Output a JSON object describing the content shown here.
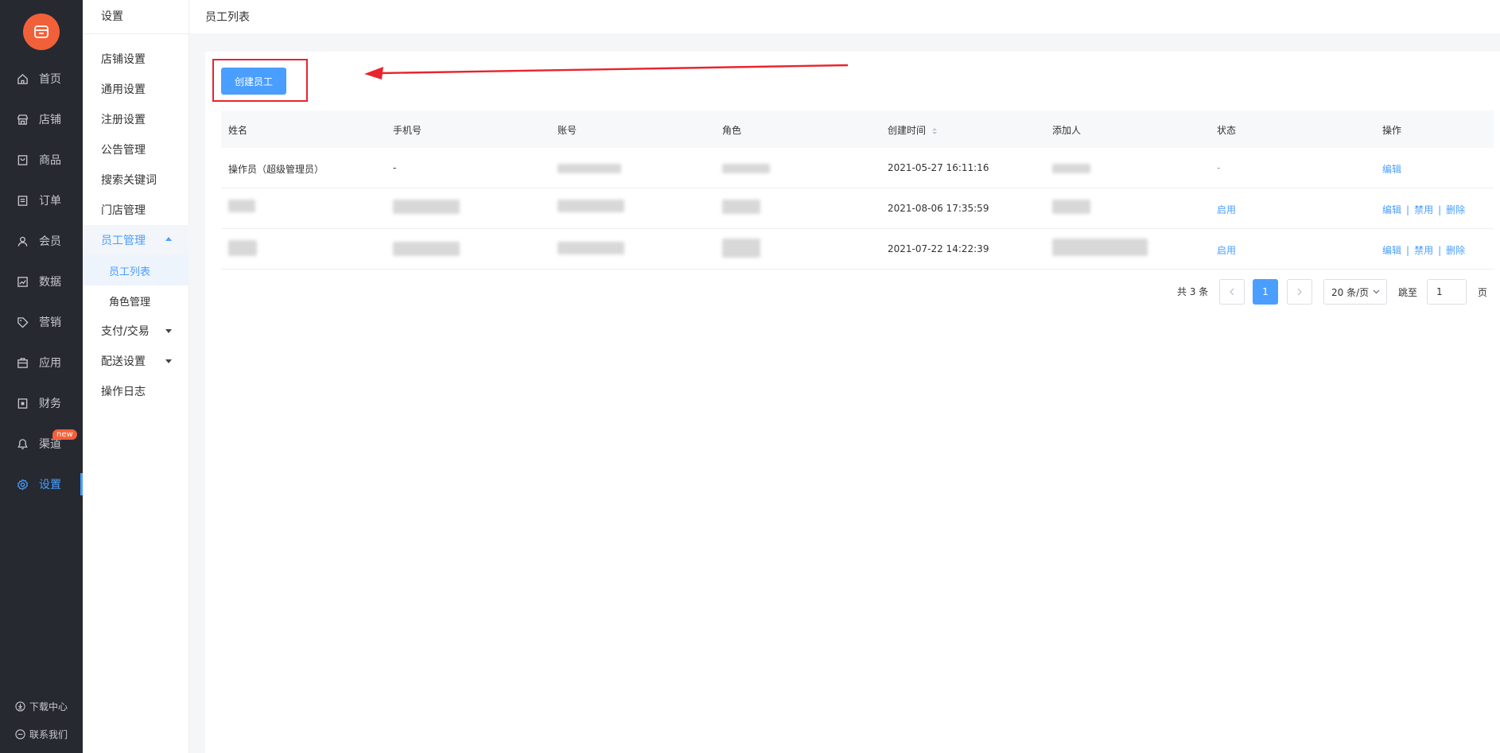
{
  "nav": {
    "items": [
      {
        "label": "首页",
        "icon": "home-icon"
      },
      {
        "label": "店铺",
        "icon": "store-icon"
      },
      {
        "label": "商品",
        "icon": "goods-icon"
      },
      {
        "label": "订单",
        "icon": "order-icon"
      },
      {
        "label": "会员",
        "icon": "member-icon"
      },
      {
        "label": "数据",
        "icon": "chart-icon"
      },
      {
        "label": "营销",
        "icon": "tag-icon"
      },
      {
        "label": "应用",
        "icon": "app-icon"
      },
      {
        "label": "财务",
        "icon": "finance-icon"
      },
      {
        "label": "渠道",
        "icon": "channel-icon",
        "badge": "new"
      },
      {
        "label": "设置",
        "icon": "gear-icon",
        "active": true
      }
    ],
    "footer": [
      {
        "label": "下载中心",
        "icon": "download-icon"
      },
      {
        "label": "联系我们",
        "icon": "chat-icon"
      }
    ]
  },
  "sub": {
    "title": "设置",
    "items": [
      {
        "label": "店铺设置"
      },
      {
        "label": "通用设置"
      },
      {
        "label": "注册设置"
      },
      {
        "label": "公告管理"
      },
      {
        "label": "搜索关键词"
      },
      {
        "label": "门店管理"
      },
      {
        "label": "员工管理",
        "expanded": true
      },
      {
        "label": "员工列表",
        "child": true,
        "selected": true
      },
      {
        "label": "角色管理",
        "child": true
      },
      {
        "label": "支付/交易",
        "collapsed": true
      },
      {
        "label": "配送设置",
        "collapsed": true
      },
      {
        "label": "操作日志"
      }
    ]
  },
  "header": {
    "title": "员工列表"
  },
  "toolbar": {
    "create_label": "创建员工"
  },
  "table": {
    "columns": [
      "姓名",
      "手机号",
      "账号",
      "角色",
      "创建时间",
      "添加人",
      "状态",
      "操作"
    ],
    "rows": [
      {
        "name": "操作员（超级管理员）",
        "phone": "-",
        "created": "2021-05-27 16:11:16",
        "status": "-",
        "actions": [
          "编辑"
        ]
      },
      {
        "name": "",
        "phone": "",
        "created": "2021-08-06 17:35:59",
        "status": "启用",
        "actions": [
          "编辑",
          "禁用",
          "删除"
        ]
      },
      {
        "name": "",
        "phone": "",
        "created": "2021-07-22 14:22:39",
        "status": "启用",
        "actions": [
          "编辑",
          "禁用",
          "删除"
        ]
      }
    ]
  },
  "pagination": {
    "total": "共 3 条",
    "current_page": "1",
    "page_size": "20 条/页",
    "jump_label": "跳至",
    "jump_value": "1",
    "page_unit": "页"
  },
  "colors": {
    "accent": "#4a9eff",
    "nav_bg": "#272930",
    "logo": "#f2603a",
    "highlight": "#e8242d"
  }
}
